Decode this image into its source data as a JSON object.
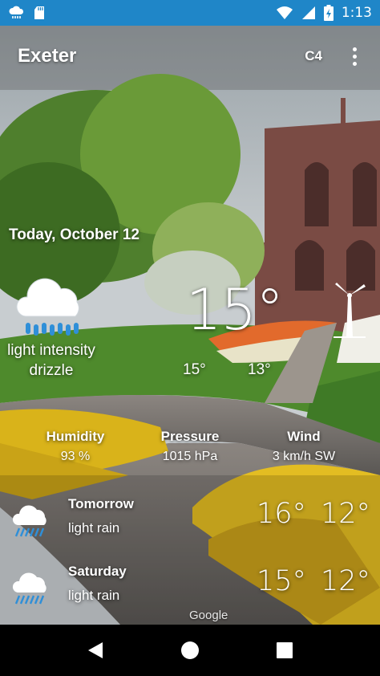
{
  "status_bar": {
    "time": "1:13",
    "icons": [
      "weather-cloud-icon",
      "sd-card-icon",
      "wifi-icon",
      "signal-icon",
      "battery-charging-icon"
    ]
  },
  "app_bar": {
    "city": "Exeter",
    "unit_toggle": "C4",
    "menu_icon": "overflow-menu-icon"
  },
  "current": {
    "date": "Today, October 12",
    "icon": "drizzle-cloud-icon",
    "condition": "light intensity drizzle",
    "temperature": "15°",
    "high": "15°",
    "low": "13°",
    "wind_icon": "wind-turbine-icon"
  },
  "stats": {
    "humidity": {
      "label": "Humidity",
      "value": "93 %"
    },
    "pressure": {
      "label": "Pressure",
      "value": "1015 hPa"
    },
    "wind": {
      "label": "Wind",
      "value": "3 km/h SW"
    }
  },
  "forecast": [
    {
      "day": "Tomorrow",
      "desc": "light rain",
      "high": "16°",
      "low": "12°",
      "icon": "rain-cloud-icon"
    },
    {
      "day": "Saturday",
      "desc": "light rain",
      "high": "15°",
      "low": "12°",
      "icon": "rain-cloud-icon"
    }
  ],
  "attribution": "Google",
  "nav": {
    "back": "back-icon",
    "home": "home-icon",
    "recents": "recents-icon"
  },
  "colors": {
    "status_bar": "#1f86c8",
    "grass": "#4e8a2c",
    "flowers": "#e9c21a"
  }
}
